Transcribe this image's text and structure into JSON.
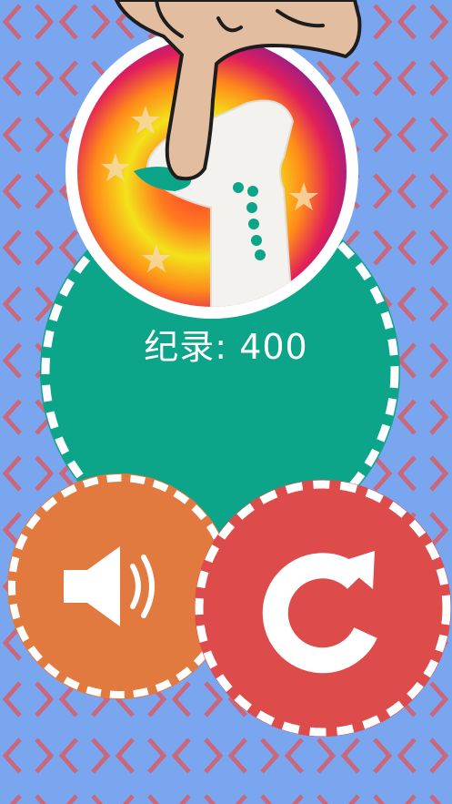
{
  "colors": {
    "background": "#7aa6f0",
    "chevron": "#c9687c",
    "main_circle": "#0da58a",
    "sound_button": "#e27a3f",
    "restart_button": "#de4b4b",
    "dash": "#ffffff"
  },
  "score": {
    "label": "纪录:",
    "value": "400"
  },
  "icons": {
    "logo": "finger-tap-logo-icon",
    "sound": "speaker-icon",
    "restart": "restart-arrow-icon"
  }
}
